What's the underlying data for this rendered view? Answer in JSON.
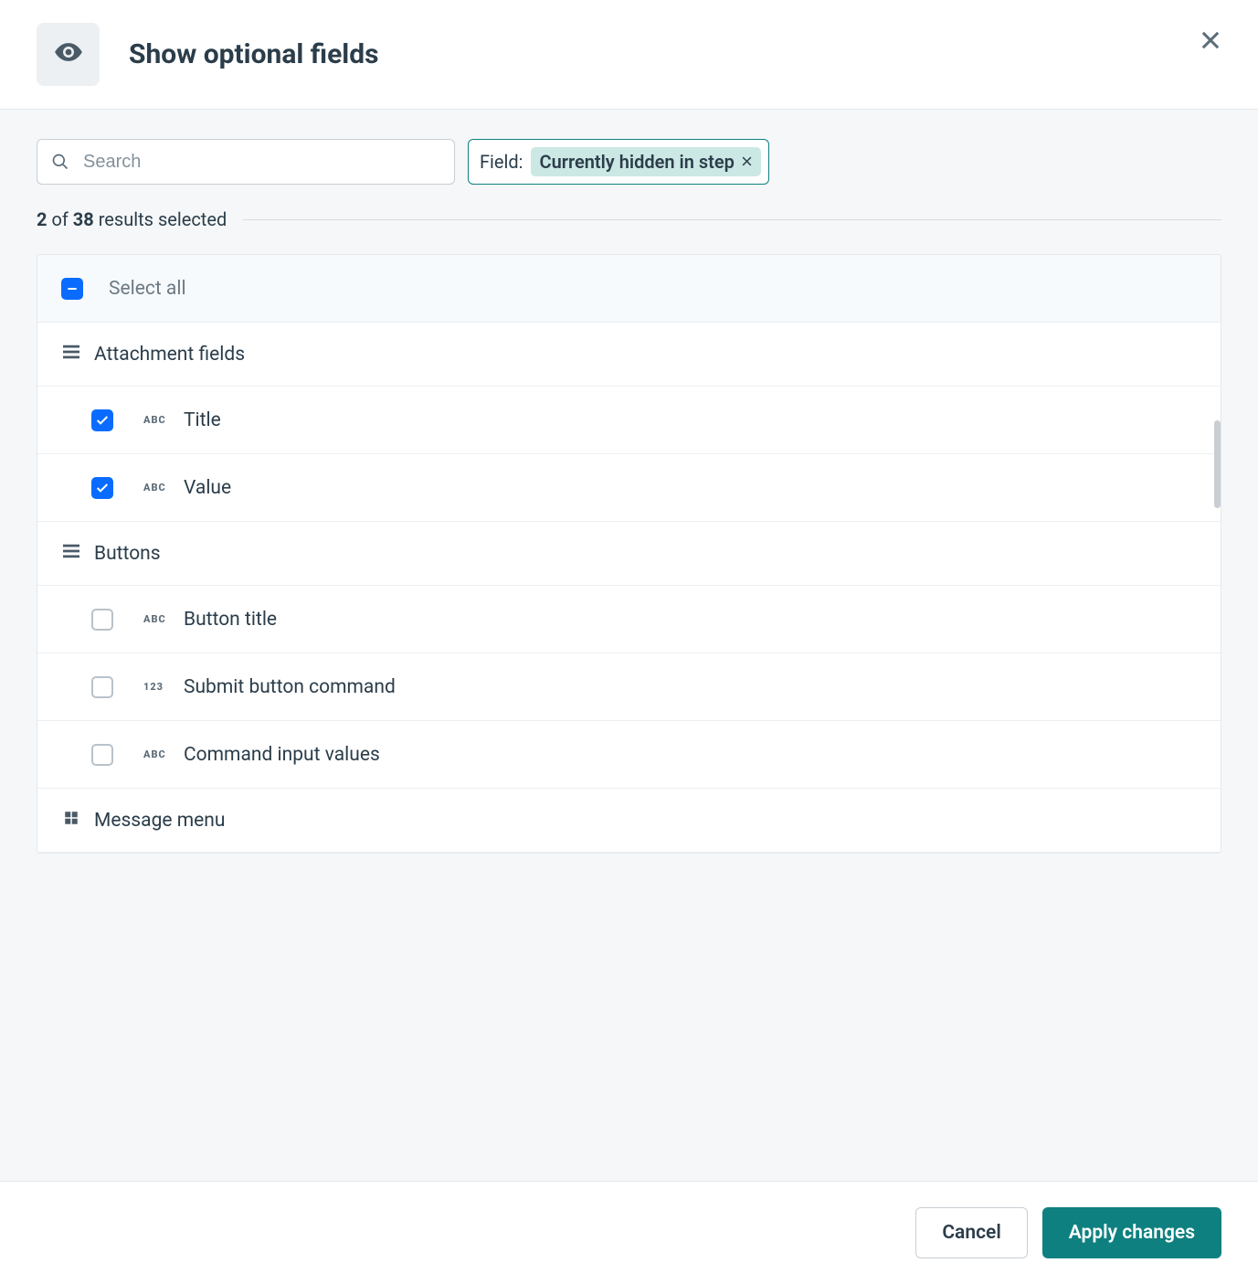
{
  "header": {
    "title": "Show optional fields"
  },
  "search": {
    "placeholder": "Search",
    "value": ""
  },
  "filter": {
    "label": "Field:",
    "chip": "Currently hidden in step"
  },
  "summary": {
    "selected": "2",
    "of_word": "of",
    "total": "38",
    "suffix": "results selected"
  },
  "list": {
    "select_all_label": "Select all",
    "type_icons": {
      "abc": "ABC",
      "num": "123"
    },
    "groups": [
      {
        "label": "Attachment fields",
        "icon": "list",
        "items": [
          {
            "label": "Title",
            "type": "abc",
            "checked": true
          },
          {
            "label": "Value",
            "type": "abc",
            "checked": true
          }
        ]
      },
      {
        "label": "Buttons",
        "icon": "list",
        "items": [
          {
            "label": "Button title",
            "type": "abc",
            "checked": false
          },
          {
            "label": "Submit button command",
            "type": "num",
            "checked": false
          },
          {
            "label": "Command input values",
            "type": "abc",
            "checked": false
          }
        ]
      },
      {
        "label": "Message menu",
        "icon": "grid",
        "items": []
      }
    ]
  },
  "footer": {
    "cancel": "Cancel",
    "apply": "Apply changes"
  }
}
